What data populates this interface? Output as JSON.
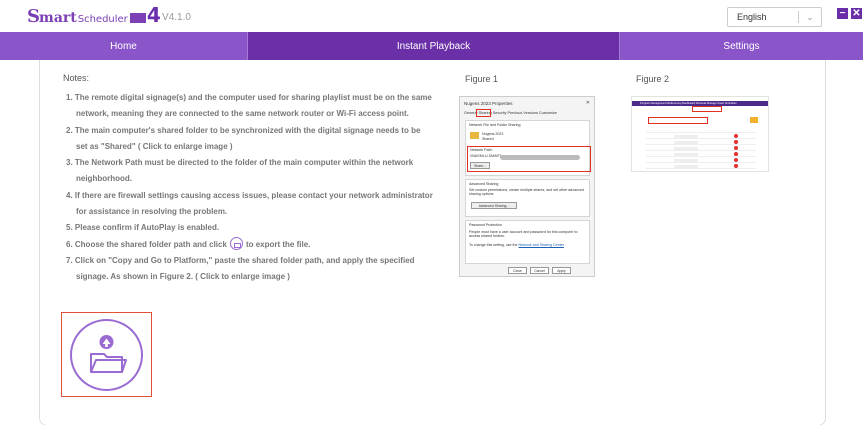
{
  "app": {
    "logo": {
      "s": "S",
      "mart": "mart",
      "scheduler": "Scheduler",
      "four": "4"
    },
    "version": "V4.1.0",
    "language": {
      "selected": "English"
    },
    "window_controls": {
      "minimize": "−",
      "close": "✕"
    }
  },
  "nav": {
    "tabs": [
      {
        "label": "Home",
        "active": false
      },
      {
        "label": "Instant Playback",
        "active": true
      },
      {
        "label": "Settings",
        "active": false
      }
    ]
  },
  "notes": {
    "title": "Notes:",
    "items": [
      {
        "line1": "1. The remote digital signage(s) and the computer used for sharing playlist must be on the same",
        "line2": "network, meaning they are connected to the same network router or Wi-Fi access point."
      },
      {
        "line1": "2. The main computer's shared folder to be synchronized with the digital signage needs to be",
        "line2": "set as \"Shared\"  ( Click to enlarge image )"
      },
      {
        "line1": "3. The Network Path must be directed to the folder of the main computer within the network",
        "line2": "neighborhood."
      },
      {
        "line1": "4. If there are firewall settings causing access issues, please contact your network administrator",
        "line2": "for assistance in resolving the problem."
      },
      {
        "line1": "5. Please confirm if AutoPlay is enabled."
      },
      {
        "before": "6. Choose the shared folder path and click",
        "after": "to export the file."
      },
      {
        "line1": "7. Click on \"Copy and Go to Platform,\" paste the shared folder path, and apply the specified",
        "line2": "signage. As shown in Figure 2.  ( Click to enlarge image )"
      }
    ]
  },
  "figures": {
    "fig1": {
      "label": "Figure 1",
      "title": "Nugens 2023 Properties",
      "close": "✕",
      "tabs": "General  Sharing  Security  Previous Versions  Customize",
      "section1": "Network File and Folder Sharing",
      "folder_name": "Nugens 2023",
      "folder_state": "Shared",
      "network_path_label": "Network Path:",
      "network_path": "\\\\NAGMI-U-SMART",
      "share_button": "Share...",
      "section2": "Advanced Sharing",
      "section2_text": "Set custom permissions, create multiple shares, and set other advanced sharing options",
      "advanced_button": "Advanced Sharing...",
      "section3": "Password Protection",
      "section3_text": "People must have a user account and password for this computer to access shared folders.",
      "section3_link_prefix": "To change this setting, use the",
      "section3_link": "Network and Sharing Center",
      "buttons": {
        "close": "Close",
        "cancel": "Cancel",
        "apply": "Apply"
      }
    },
    "fig2": {
      "label": "Figure 2",
      "menu": "Program   Management   Media   Group   Dashboard   Schedule   Manage   Smart Scheduler"
    }
  },
  "colors": {
    "nav_purple": "#8a55c8",
    "nav_active": "#6b2fa8",
    "accent": "#9a6bd2",
    "highlight_red": "#e05038"
  },
  "icons": {
    "export": "folder-upload-icon",
    "inline": "folder-export-icon"
  }
}
